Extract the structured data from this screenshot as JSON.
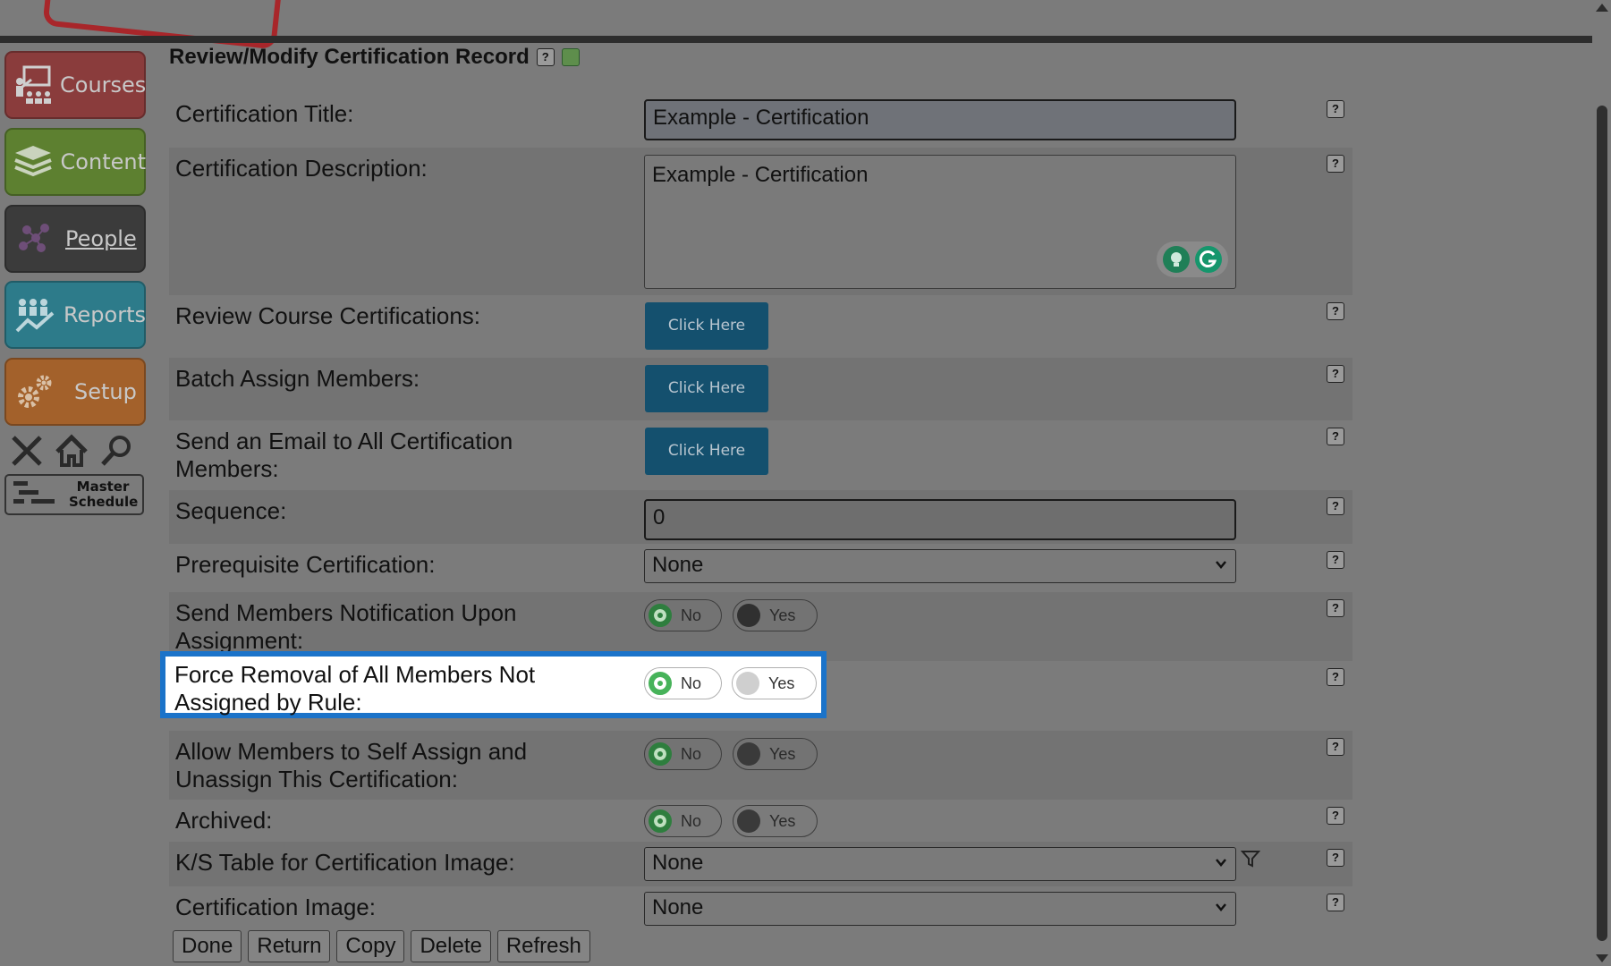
{
  "page": {
    "title": "Review/Modify Certification Record",
    "help": "?"
  },
  "nav": {
    "courses": "Courses",
    "content": "Content",
    "people": "People",
    "reports": "Reports",
    "setup": "Setup",
    "master_schedule_line1": "Master",
    "master_schedule_line2": "Schedule"
  },
  "form": {
    "certification_title": {
      "label": "Certification Title:",
      "value": "Example - Certification"
    },
    "certification_description": {
      "label": "Certification Description:",
      "value": "Example - Certification"
    },
    "review_course_certifications": {
      "label": "Review Course Certifications:",
      "button": "Click Here"
    },
    "batch_assign_members": {
      "label": "Batch Assign Members:",
      "button": "Click Here"
    },
    "send_email": {
      "label": "Send an Email to All Certification Members:",
      "button": "Click Here"
    },
    "sequence": {
      "label": "Sequence:",
      "value": "0"
    },
    "prerequisite": {
      "label": "Prerequisite Certification:",
      "selected": "None"
    },
    "notify_upon_assignment": {
      "label": "Send Members Notification Upon Assignment:",
      "no": "No",
      "yes": "Yes",
      "selected": "No"
    },
    "force_removal": {
      "label": "Force Removal of All Members Not Assigned by Rule:",
      "no": "No",
      "yes": "Yes",
      "selected": "No"
    },
    "self_assign": {
      "label": "Allow Members to Self Assign and Unassign This Certification:",
      "no": "No",
      "yes": "Yes",
      "selected": "No"
    },
    "archived": {
      "label": "Archived:",
      "no": "No",
      "yes": "Yes",
      "selected": "No"
    },
    "ks_table": {
      "label": "K/S Table for Certification Image:",
      "selected": "None"
    },
    "certification_image": {
      "label": "Certification Image:",
      "selected": "None"
    }
  },
  "buttons": {
    "done": "Done",
    "return": "Return",
    "copy": "Copy",
    "delete": "Delete",
    "refresh": "Refresh"
  },
  "colors": {
    "highlight_border": "#1b73c9",
    "action_button": "#14506e",
    "toggle_on": "#47b35a"
  }
}
